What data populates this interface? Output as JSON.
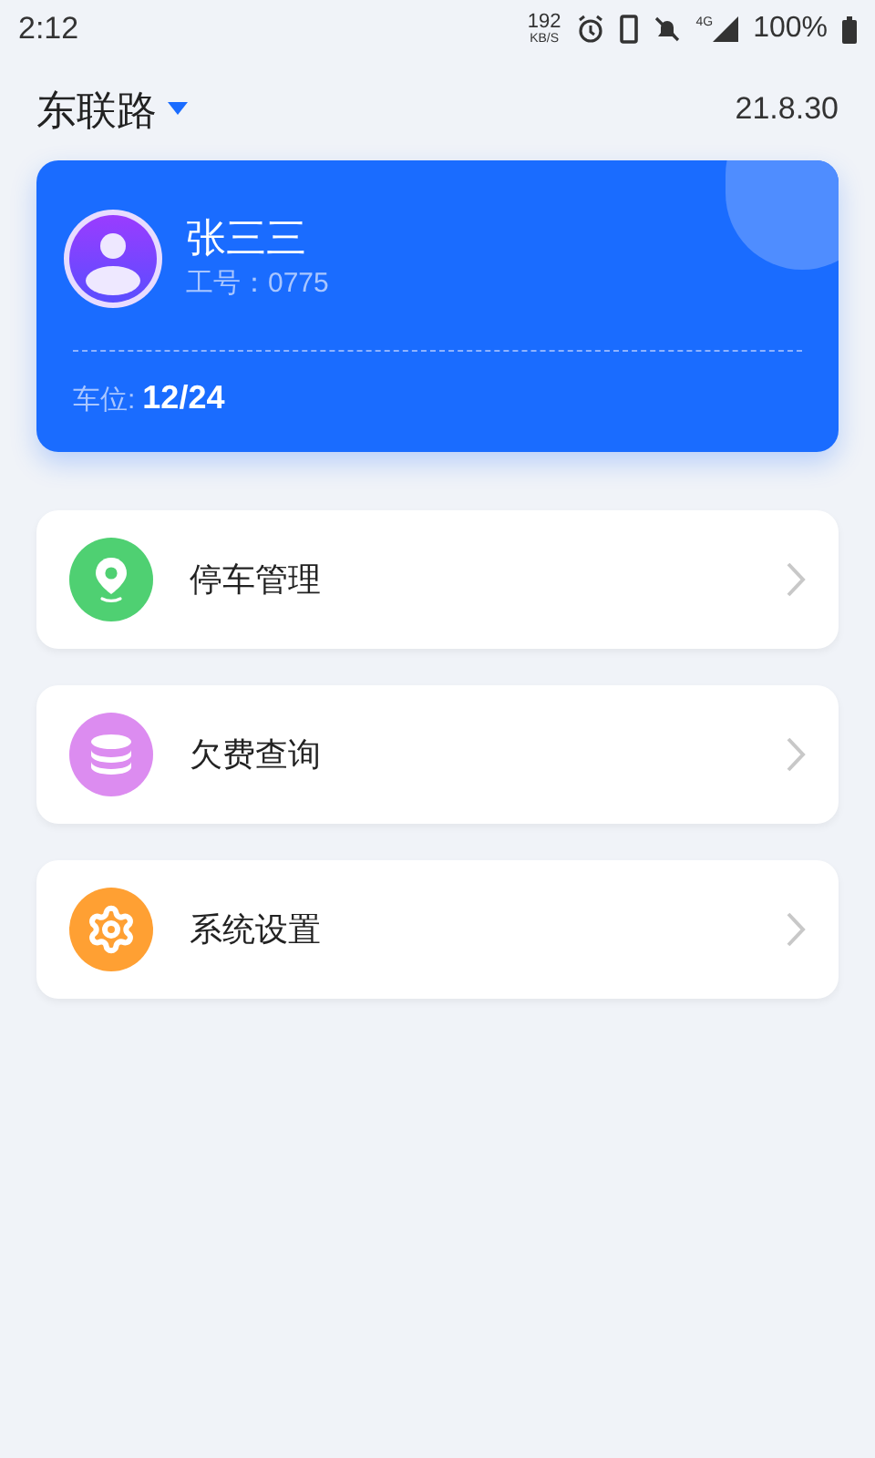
{
  "status_bar": {
    "time": "2:12",
    "speed": "192",
    "speed_unit": "KB/S",
    "network": "4G",
    "battery": "100%"
  },
  "header": {
    "location": "东联路",
    "date": "21.8.30"
  },
  "profile": {
    "name": "张三三",
    "employee_id": "工号：0775",
    "spaces_label": "车位:",
    "spaces_value": "12/24"
  },
  "menu": [
    {
      "kind": "pin",
      "label": "停车管理",
      "color": "#4fd072"
    },
    {
      "kind": "coins",
      "label": "欠费查询",
      "color": "#dc8cf0"
    },
    {
      "kind": "gear",
      "label": "系统设置",
      "color": "#ffa033"
    }
  ]
}
